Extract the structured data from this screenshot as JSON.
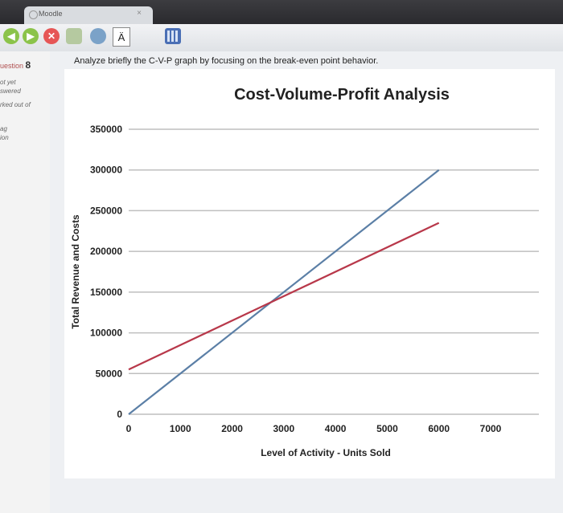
{
  "browser": {
    "tab_title": "Moodle",
    "tab_close": "×",
    "text_tool": "Ä",
    "nav_back": "◀",
    "nav_forward": "▶",
    "stop": "✕"
  },
  "sidebar": {
    "question_prefix": "uestion",
    "question_number": "8",
    "status_1": "ot yet",
    "status_2": "swered",
    "status_3": "rked out of",
    "flag_1": "ag",
    "flag_2": "ion"
  },
  "question_text": "Analyze briefly the C-V-P graph by focusing on the break-even point behavior.",
  "colors": {
    "revenue": "#5b7fa6",
    "costs": "#b8384a",
    "grid": "#bfbfbf"
  },
  "chart_data": {
    "type": "line",
    "title": "Cost-Volume-Profit Analysis",
    "xlabel": "Level of Activity - Units Sold",
    "ylabel": "Total Revenue and Costs",
    "xlim": [
      0,
      7000
    ],
    "ylim": [
      0,
      350000
    ],
    "x_ticks": [
      "0",
      "1000",
      "2000",
      "3000",
      "4000",
      "5000",
      "6000",
      "7000"
    ],
    "y_ticks": [
      "0",
      "50000",
      "100000",
      "150000",
      "200000",
      "250000",
      "300000",
      "350000"
    ],
    "grid": true,
    "series": [
      {
        "x": [
          0,
          6000
        ],
        "y": [
          0,
          300000
        ]
      },
      {
        "x": [
          0,
          6000
        ],
        "y": [
          55000,
          235000
        ]
      }
    ]
  }
}
